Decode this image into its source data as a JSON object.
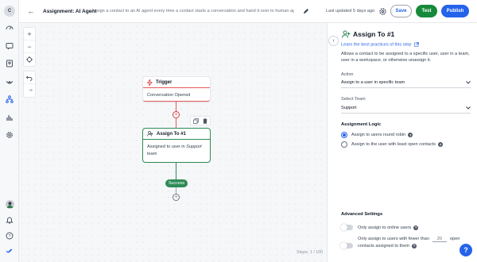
{
  "app": {
    "logo_letter": "C"
  },
  "header": {
    "title": "Assignment: AI Agent",
    "description": "Assign a contact to an AI agent every time a contact starts a conversation and hand it over to human agent...",
    "updated": "Last updated 5 days ago",
    "save_label": "Save",
    "test_label": "Test",
    "publish_label": "Publish"
  },
  "canvas": {
    "trigger_node": {
      "title": "Trigger",
      "body": "Conversation Opened"
    },
    "assign_node": {
      "title": "Assign To #1",
      "body_prefix": "Assigned to user in ",
      "body_team": "Support",
      "body_suffix": " team"
    },
    "success_label": "Success",
    "steps": "Steps: 1 / 100"
  },
  "panel": {
    "title": "Assign To #1",
    "learn_link": "Learn the best practices of this step",
    "description": "Allows a contact to be assigned to a specific user, user in a team, user in a workspace, or otherwise unassign it.",
    "action_label": "Action",
    "action_value": "Assign to a user in specific team",
    "team_label": "Select Team",
    "team_value": "Support",
    "logic_title": "Assignment Logic",
    "logic_options": [
      "Assign to users round robin",
      "Assign to the user with least open contacts"
    ],
    "advanced_title": "Advanced Settings",
    "online_only": "Only assign to online users",
    "fewer_than_prefix": "Only assign to users with fewer than",
    "fewer_than_value": "20",
    "fewer_than_suffix": "open",
    "fewer_than_line2": "contacts assigned to them"
  },
  "colors": {
    "accent": "#2563eb",
    "success": "#2e8b57",
    "trigger": "#e45a5a",
    "test_button": "#168a3a"
  }
}
